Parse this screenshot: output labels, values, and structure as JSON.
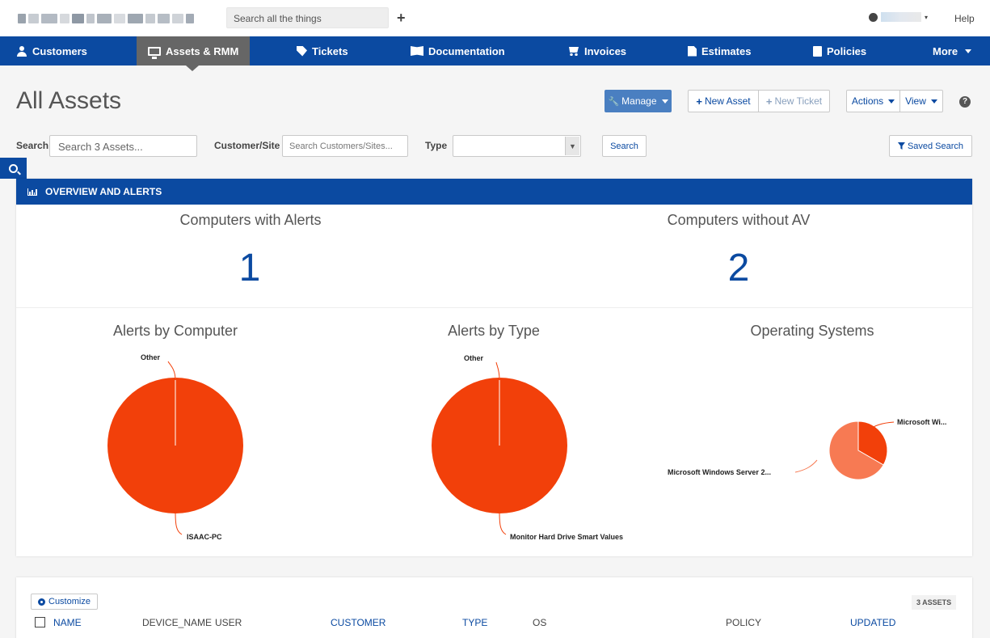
{
  "topbar": {
    "search_placeholder": "Search all the things",
    "add_label": "+",
    "help_label": "Help"
  },
  "nav": {
    "items": [
      {
        "label": "Customers",
        "icon": "user-icon"
      },
      {
        "label": "Assets & RMM",
        "icon": "monitor-icon",
        "active": true
      },
      {
        "label": "Tickets",
        "icon": "tag-icon"
      },
      {
        "label": "Documentation",
        "icon": "book-icon"
      },
      {
        "label": "Invoices",
        "icon": "cart-icon"
      },
      {
        "label": "Estimates",
        "icon": "document-icon"
      },
      {
        "label": "Policies",
        "icon": "policy-icon"
      },
      {
        "label": "More",
        "icon": "caret-down-icon"
      }
    ],
    "color": "#0b4aa1",
    "active_color": "#666666"
  },
  "page": {
    "title": "All Assets",
    "manage_label": "Manage",
    "new_asset_label": "New Asset",
    "new_ticket_label": "New Ticket",
    "actions_label": "Actions",
    "view_label": "View",
    "help_icon": "question-circle-icon"
  },
  "filters": {
    "search_label": "Search",
    "search_placeholder": "Search 3 Assets...",
    "customer_label": "Customer/Site",
    "customer_placeholder": "Search Customers/Sites...",
    "type_label": "Type",
    "type_value": "",
    "search_button": "Search",
    "saved_search_label": "Saved Search"
  },
  "overview": {
    "header": "OVERVIEW AND ALERTS",
    "stats": [
      {
        "title": "Computers with Alerts",
        "value": "1"
      },
      {
        "title": "Computers without AV",
        "value": "2"
      }
    ]
  },
  "chart_data": [
    {
      "type": "pie",
      "title": "Alerts by Computer",
      "labels": [
        "ISAAC-PC",
        "Other"
      ],
      "values": [
        1,
        0
      ],
      "colors": [
        "#f2400a",
        "#f2400a"
      ]
    },
    {
      "type": "pie",
      "title": "Alerts by Type",
      "labels": [
        "Monitor Hard Drive Smart Values",
        "Other"
      ],
      "values": [
        1,
        0
      ],
      "colors": [
        "#f2400a",
        "#f2400a"
      ]
    },
    {
      "type": "pie",
      "title": "Operating Systems",
      "labels": [
        "Microsoft Wi...",
        "Microsoft Windows Server 2..."
      ],
      "values": [
        1,
        2
      ],
      "colors": [
        "#f2400a",
        "#f77a53"
      ]
    }
  ],
  "table": {
    "customize_label": "Customize",
    "count_label": "3 ASSETS",
    "columns": [
      {
        "label": "NAME",
        "sortable": true
      },
      {
        "label": "DEVICE_NAME",
        "sortable": false
      },
      {
        "label": "USER",
        "sortable": false
      },
      {
        "label": "CUSTOMER",
        "sortable": true
      },
      {
        "label": "TYPE",
        "sortable": true
      },
      {
        "label": "OS",
        "sortable": false
      },
      {
        "label": "POLICY",
        "sortable": false
      },
      {
        "label": "UPDATED",
        "sortable": true
      }
    ]
  }
}
